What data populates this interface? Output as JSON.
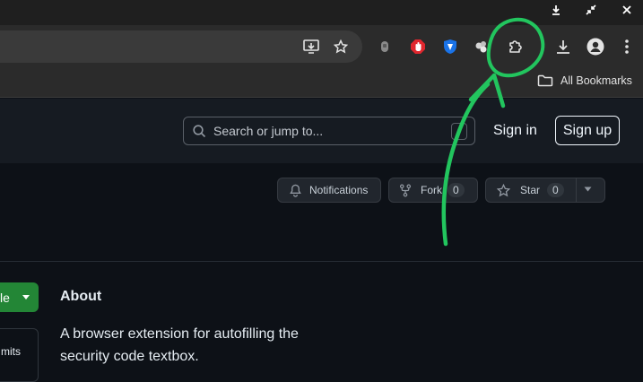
{
  "browser": {
    "bookmarks_label": "All Bookmarks",
    "colors": {
      "titlebar": "#1f1f1f",
      "toolbar": "#2b2b2b",
      "omnibox": "#3a3a3a"
    }
  },
  "github": {
    "search_placeholder": "Search or jump to...",
    "search_shortcut": "/",
    "sign_in": "Sign in",
    "sign_up": "Sign up",
    "notifications_label": "Notifications",
    "fork_label": "Fork",
    "fork_count": "0",
    "star_label": "Star",
    "star_count": "0",
    "code_button_partial": "le",
    "commits_partial": "mits",
    "about_heading": "About",
    "about_description": "A browser extension for autofilling the security code textbox.",
    "colors": {
      "header": "#161b22",
      "page": "#0d1117",
      "green_button": "#238636",
      "annotation": "#22c55e"
    }
  }
}
